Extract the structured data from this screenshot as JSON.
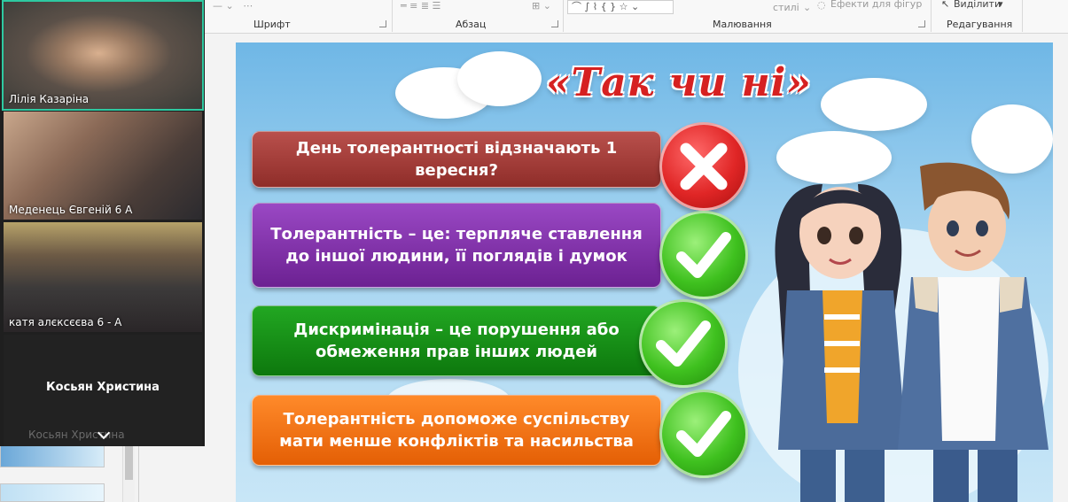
{
  "ribbon": {
    "groups": [
      "Шрифт",
      "Абзац",
      "Малювання",
      "Редагування"
    ],
    "styles_label": "стилі",
    "effects_label": "Ефекти для фігур",
    "select_label": "Виділити"
  },
  "video_call": {
    "participants": [
      {
        "name": "Лілія Казаріна",
        "active": true
      },
      {
        "name": "Меденець Євгеній 6 А",
        "active": false
      },
      {
        "name": "катя алєксєєва 6 - А",
        "active": false
      },
      {
        "name": "Косьян Христина",
        "video": false
      }
    ],
    "overflow_name": "Косьян Христина"
  },
  "slide": {
    "title": "«Так чи ні»",
    "questions": [
      {
        "text": "День толерантності відзначають 1 вересня?",
        "answer": "no",
        "color": "#a03a36"
      },
      {
        "text": "Толерантність – це: терпляче ставлення до іншої людини, її поглядів і думок",
        "answer": "yes",
        "color": "#7a2ea0"
      },
      {
        "text": "Дискримінація – це порушення або обмеження прав інших людей",
        "answer": "yes",
        "color": "#138a13"
      },
      {
        "text": "Толерантність допоможе суспільству мати менше конфліктів та насильства",
        "answer": "yes",
        "color": "#ef6f0f"
      }
    ],
    "accent_colors": {
      "title": "#d62121",
      "no": "#e02626",
      "yes": "#3fc11f"
    }
  }
}
